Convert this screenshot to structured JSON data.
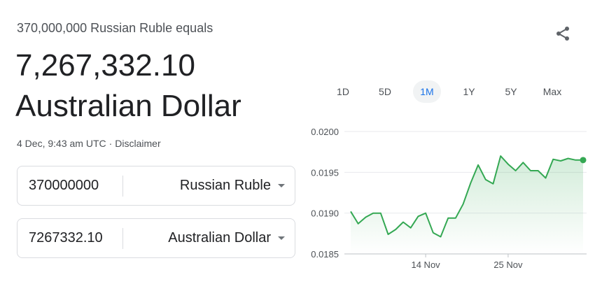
{
  "header": {
    "subtitle": "370,000,000 Russian Ruble equals",
    "amount": "7,267,332.10",
    "currency": "Australian Dollar"
  },
  "meta": {
    "timestamp": "4 Dec, 9:43 am UTC",
    "separator": "·",
    "disclaimer": "Disclaimer"
  },
  "icons": {
    "share": "share-icon",
    "dropdown": "caret-down-icon"
  },
  "converter": {
    "from": {
      "value": "370000000",
      "currency": "Russian Ruble"
    },
    "to": {
      "value": "7267332.10",
      "currency": "Australian Dollar"
    }
  },
  "tabs": [
    {
      "label": "1D",
      "active": false
    },
    {
      "label": "5D",
      "active": false
    },
    {
      "label": "1M",
      "active": true
    },
    {
      "label": "1Y",
      "active": false
    },
    {
      "label": "5Y",
      "active": false
    },
    {
      "label": "Max",
      "active": false
    }
  ],
  "colors": {
    "line": "#34a853",
    "accent": "#1a73e8",
    "grid": "#e8eaed"
  },
  "chart_data": {
    "type": "line",
    "xlabel": "",
    "ylabel": "",
    "ylim": [
      0.0185,
      0.02
    ],
    "yticks": [
      "0.0200",
      "0.0195",
      "0.0190",
      "0.0185"
    ],
    "xticks": [
      {
        "label": "14 Nov",
        "day": 14
      },
      {
        "label": "25 Nov",
        "day": 25
      }
    ],
    "xrange": [
      4,
      35
    ],
    "grid": true,
    "series": [
      {
        "x": [
          4,
          5,
          6,
          7,
          8,
          9,
          10,
          11,
          12,
          13,
          14,
          15,
          16,
          17,
          18,
          19,
          20,
          21,
          22,
          23,
          24,
          25,
          26,
          27,
          28,
          29,
          30,
          31,
          32,
          33,
          34,
          35
        ],
        "values": [
          0.01902,
          0.01887,
          0.01895,
          0.019,
          0.019,
          0.01874,
          0.0188,
          0.01889,
          0.01882,
          0.01896,
          0.019,
          0.01876,
          0.01871,
          0.01894,
          0.01894,
          0.01911,
          0.01937,
          0.01959,
          0.01941,
          0.01936,
          0.0197,
          0.0196,
          0.01952,
          0.01962,
          0.01952,
          0.01952,
          0.01943,
          0.01966,
          0.01964,
          0.01967,
          0.01965,
          0.01965
        ]
      }
    ]
  }
}
